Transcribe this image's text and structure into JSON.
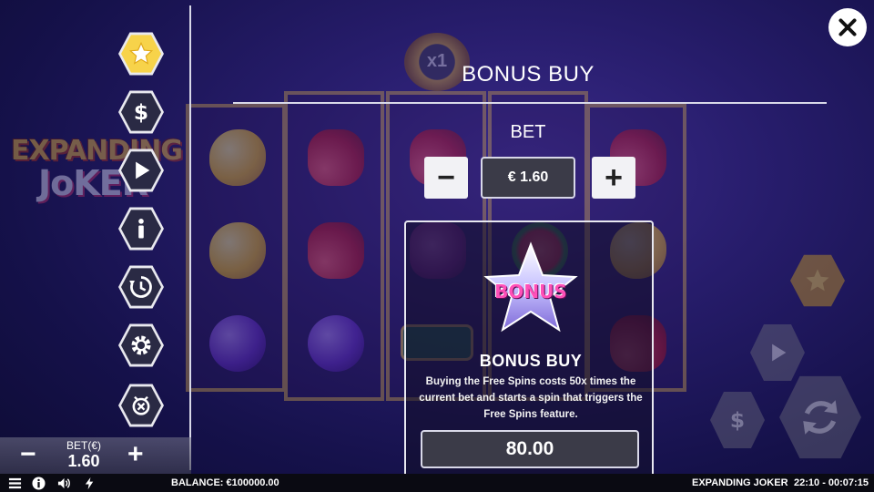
{
  "game": {
    "logo_line1": "EXPANDING",
    "logo_line2": "JoKER",
    "multiplier": "x1"
  },
  "side_menu": {
    "items": [
      {
        "icon": "star-icon",
        "active": true
      },
      {
        "icon": "dollar-icon",
        "active": false
      },
      {
        "icon": "play-icon",
        "active": false
      },
      {
        "icon": "info-icon",
        "active": false
      },
      {
        "icon": "history-icon",
        "active": false
      },
      {
        "icon": "gear-icon",
        "active": false
      },
      {
        "icon": "autoplay-icon",
        "active": false
      }
    ]
  },
  "bet_box": {
    "minus": "−",
    "label": "BET(€)",
    "value": "1.60",
    "plus": "+"
  },
  "bonus_panel": {
    "title": "BONUS BUY",
    "bet_heading": "BET",
    "minus": "−",
    "bet_value": "€ 1.60",
    "plus": "+",
    "star_text": "BONUS",
    "card_title": "BONUS BUY",
    "description": "Buying the Free Spins costs 50x times the current bet and starts a spin that triggers the Free Spins feature.",
    "price": "80.00"
  },
  "reel_symbols": [
    [
      "lemon",
      "lemon",
      "plum"
    ],
    [
      "cherry",
      "cherry",
      "plum"
    ],
    [
      "cherry",
      "grape",
      "bar"
    ],
    [
      "dice",
      "melon",
      "cherry"
    ],
    [
      "cherry",
      "lemon",
      "cherry"
    ]
  ],
  "status_bar": {
    "balance": "BALANCE: €100000.00",
    "game_name": "EXPANDING JOKER",
    "clock": "22:10 - 00:07:15"
  },
  "colors": {
    "accent_gold": "#f7d34a",
    "panel_dark": "#3b3b48",
    "status_bar_bg": "#0a0a12"
  }
}
